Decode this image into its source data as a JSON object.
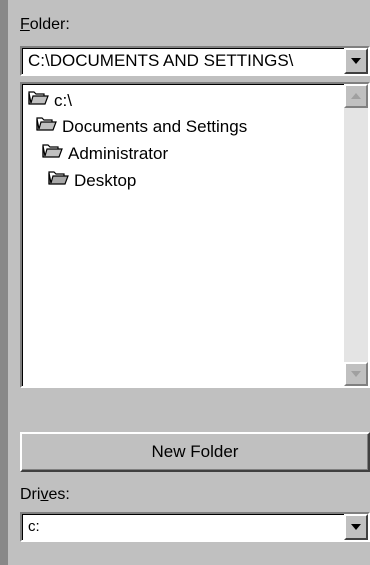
{
  "folder_label_prefix": "F",
  "folder_label_rest": "older:",
  "folder_combo_value": "C:\\DOCUMENTS AND SETTINGS\\",
  "tree": [
    {
      "label": "c:\\"
    },
    {
      "label": "Documents and Settings"
    },
    {
      "label": "Administrator"
    },
    {
      "label": "Desktop"
    }
  ],
  "new_folder_label": "New Folder",
  "drives_label_prefix": "Dri",
  "drives_label_hotkey": "v",
  "drives_label_rest": "es:",
  "drives_combo_value": "c:",
  "icons": {
    "open_folder": "open-folder-icon",
    "dropdown": "chevron-down-icon",
    "scroll_up": "scroll-up-arrow-icon",
    "scroll_down": "scroll-down-arrow-icon"
  }
}
